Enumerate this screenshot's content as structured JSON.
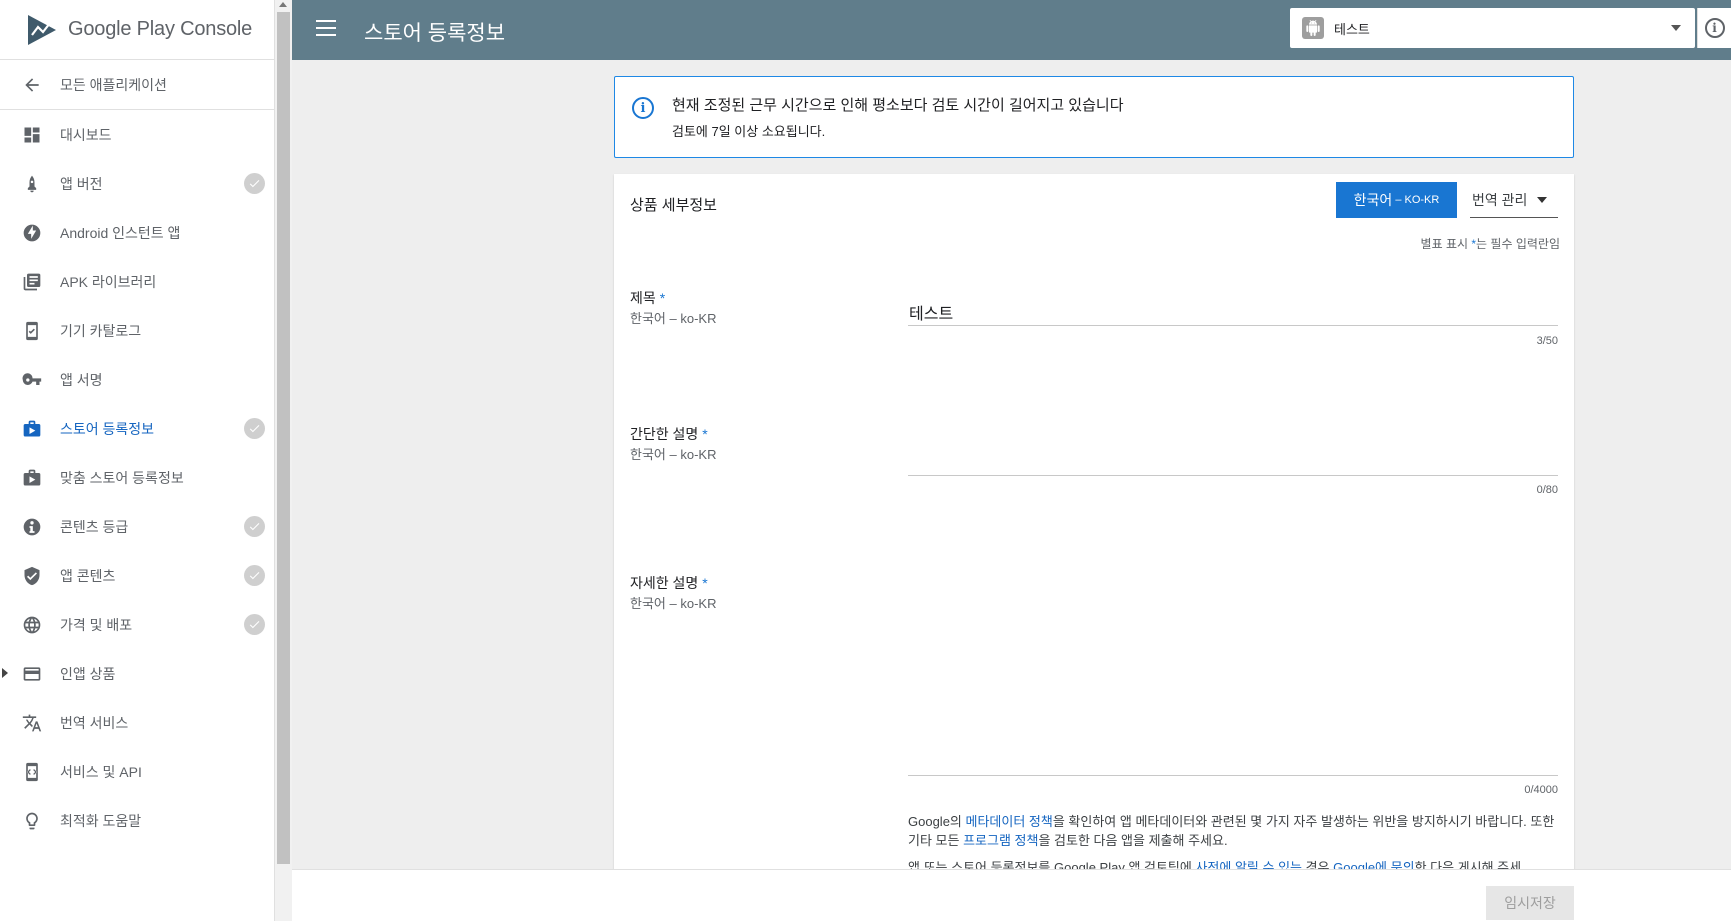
{
  "brand": {
    "logo_text": "Google Play Console"
  },
  "sidebar": {
    "back_label": "모든 애플리케이션",
    "items": [
      {
        "label": "대시보드",
        "icon": "dashboard-icon",
        "checked": false,
        "active": false
      },
      {
        "label": "앱 버전",
        "icon": "rocket-icon",
        "checked": true,
        "active": false
      },
      {
        "label": "Android 인스턴트 앱",
        "icon": "bolt-icon",
        "checked": false,
        "active": false
      },
      {
        "label": "APK 라이브러리",
        "icon": "library-icon",
        "checked": false,
        "active": false
      },
      {
        "label": "기기 카탈로그",
        "icon": "device-check-icon",
        "checked": false,
        "active": false
      },
      {
        "label": "앱 서명",
        "icon": "key-icon",
        "checked": false,
        "active": false
      },
      {
        "label": "스토어 등록정보",
        "icon": "store-play-icon",
        "checked": true,
        "active": true
      },
      {
        "label": "맞춤 스토어 등록정보",
        "icon": "store-play-icon",
        "checked": false,
        "active": false
      },
      {
        "label": "콘텐츠 등급",
        "icon": "rating-icon",
        "checked": true,
        "active": false
      },
      {
        "label": "앱 콘텐츠",
        "icon": "shield-check-icon",
        "checked": true,
        "active": false
      },
      {
        "label": "가격 및 배포",
        "icon": "globe-icon",
        "checked": true,
        "active": false
      },
      {
        "label": "인앱 상품",
        "icon": "credit-card-icon",
        "checked": false,
        "active": false,
        "expandable": true
      },
      {
        "label": "번역 서비스",
        "icon": "translate-icon",
        "checked": false,
        "active": false
      },
      {
        "label": "서비스 및 API",
        "icon": "api-device-icon",
        "checked": false,
        "active": false
      },
      {
        "label": "최적화 도움말",
        "icon": "lightbulb-icon",
        "checked": false,
        "active": false
      }
    ]
  },
  "header": {
    "title": "스토어 등록정보",
    "app_selector": {
      "value": "테스트"
    }
  },
  "notice": {
    "title": "현재 조정된 근무 시간으로 인해 평소보다 검토 시간이 길어지고 있습니다",
    "subtitle": "검토에 7일 이상 소요됩니다."
  },
  "form": {
    "section_title": "상품 세부정보",
    "language_button": {
      "label": "한국어",
      "code": "– KO-KR"
    },
    "translation_manage": "번역 관리",
    "required_note_prefix": "별표 표시",
    "required_note_star": "*",
    "required_note_suffix": "는 필수 입력란임",
    "fields": {
      "title": {
        "label": "제목",
        "star": "*",
        "lang": "한국어 – ko-KR",
        "value": "테스트",
        "counter": "3/50"
      },
      "short_desc": {
        "label": "간단한 설명",
        "star": "*",
        "lang": "한국어 – ko-KR",
        "value": "",
        "counter": "0/80"
      },
      "full_desc": {
        "label": "자세한 설명",
        "star": "*",
        "lang": "한국어 – ko-KR",
        "value": "",
        "counter": "0/4000"
      }
    },
    "policy": {
      "line1_a": "Google의 ",
      "line1_link": "메타데이터 정책",
      "line1_b": "을 확인하여 앱 메타데이터와 관련된 몇 가지 자주 발생하는 위반을 방지하시기 바랍니다. 또한 기타 모든 ",
      "line1_link2": "프로그램 정책",
      "line1_c": "을 검토한 다음 앱을 제출해 주세요.",
      "line2_a": "앱 또는 스토어 등록정보를 Google Play 앱 검토팀에 ",
      "line2_link": "사전에 알릴 수 있는",
      "line2_b": " 경우 ",
      "line2_link2": "Google에 문의",
      "line2_c": "한 다음 게시해 주세"
    }
  },
  "footer": {
    "save_draft": "임시저장"
  }
}
